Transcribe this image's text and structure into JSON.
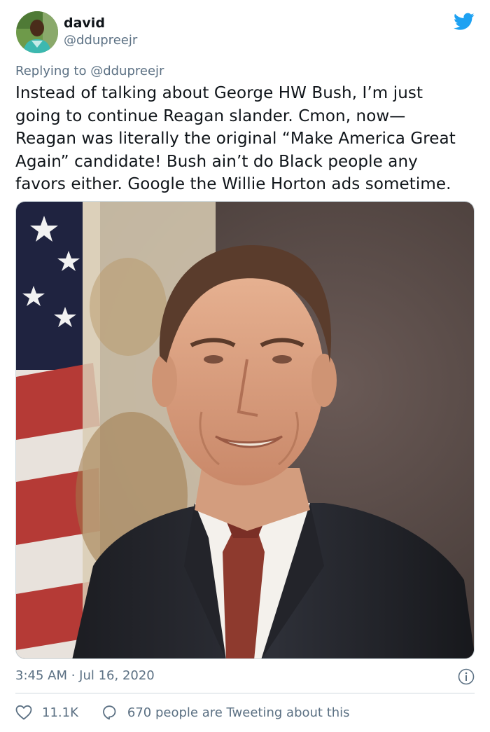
{
  "author": {
    "display_name": "david",
    "handle": "@ddupreejr",
    "avatar_icon": "profile-photo"
  },
  "brand_icon": "twitter-bird-icon",
  "brand_color": "#1da1f2",
  "reply_context": "Replying to @ddupreejr",
  "tweet_text": "Instead of talking about George HW Bush, I’m just\ngoing to continue Reagan slander. Cmon, now—\nReagan was literally the original “Make America Great\nAgain” candidate! Bush ain’t do Black people any\nfavors either. Google the Willie Horton ads sometime.",
  "media": {
    "type": "photo"
  },
  "timestamp": "3:45 AM · Jul 16, 2020",
  "stats": {
    "likes": "11.1K",
    "conversation": "670 people are Tweeting about this"
  }
}
